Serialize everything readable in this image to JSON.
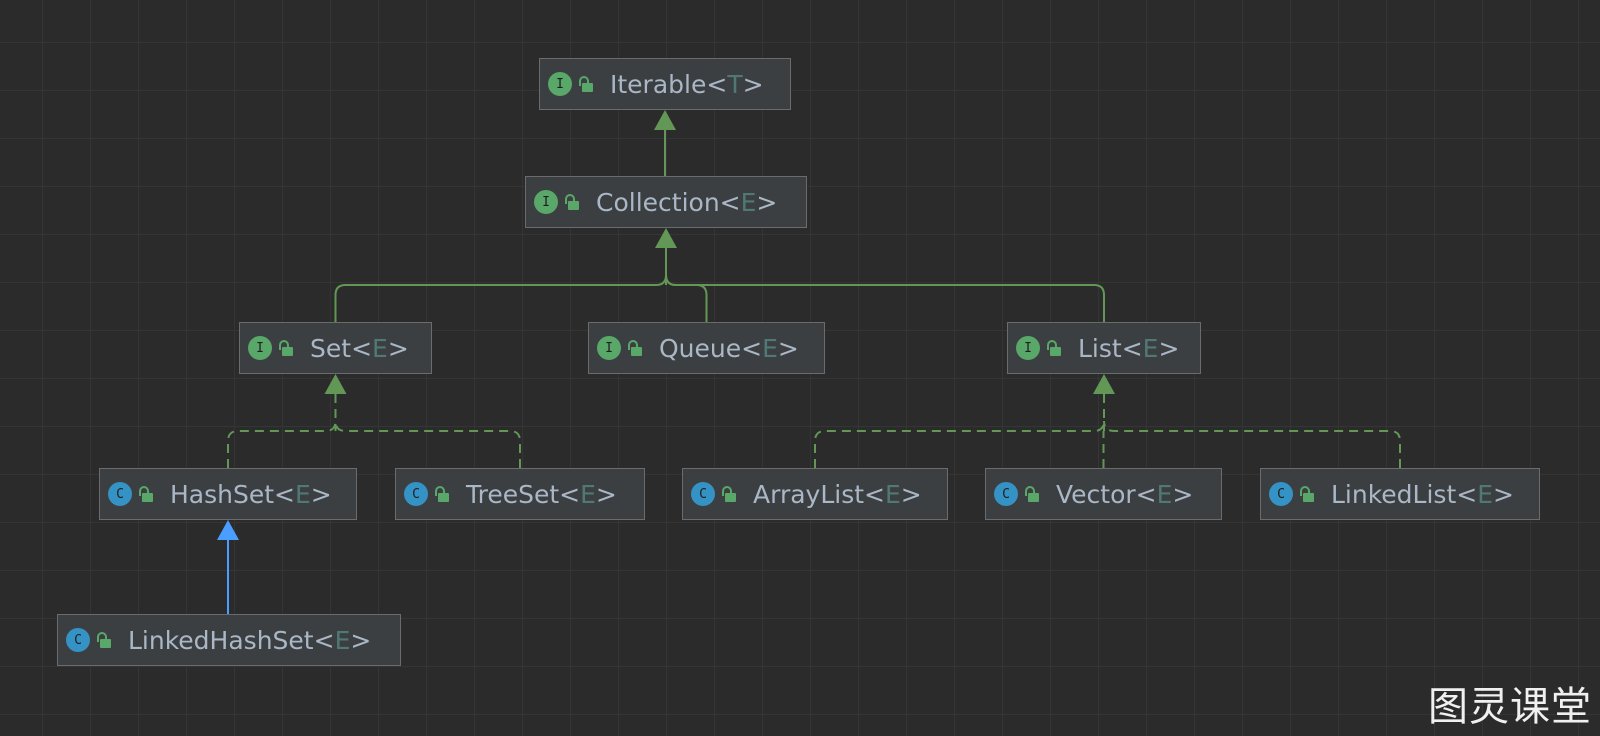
{
  "colors": {
    "background": "#2b2b2b",
    "extends_edge": "#629755",
    "implements_edge": "#629755",
    "class_extends_edge": "#4a9eff",
    "type_param": "#507874",
    "text": "#a9b7c6"
  },
  "nodes": [
    {
      "id": "iterable",
      "name": "Iterable",
      "lt": "<",
      "param": "T",
      "gt": ">",
      "kind": "interface",
      "kind_letter": "I",
      "icon": "interface-icon",
      "access_icon": "unlock-icon"
    },
    {
      "id": "collection",
      "name": "Collection",
      "lt": "<",
      "param": "E",
      "gt": ">",
      "kind": "interface",
      "kind_letter": "I",
      "icon": "interface-icon",
      "access_icon": "unlock-icon"
    },
    {
      "id": "set",
      "name": "Set",
      "lt": "<",
      "param": "E",
      "gt": ">",
      "kind": "interface",
      "kind_letter": "I",
      "icon": "interface-icon",
      "access_icon": "unlock-icon"
    },
    {
      "id": "queue",
      "name": "Queue",
      "lt": "<",
      "param": "E",
      "gt": ">",
      "kind": "interface",
      "kind_letter": "I",
      "icon": "interface-icon",
      "access_icon": "unlock-icon"
    },
    {
      "id": "list",
      "name": "List",
      "lt": "<",
      "param": "E",
      "gt": ">",
      "kind": "interface",
      "kind_letter": "I",
      "icon": "interface-icon",
      "access_icon": "unlock-icon"
    },
    {
      "id": "hashset",
      "name": "HashSet",
      "lt": "<",
      "param": "E",
      "gt": ">",
      "kind": "class",
      "kind_letter": "C",
      "icon": "class-icon",
      "access_icon": "unlock-icon"
    },
    {
      "id": "treeset",
      "name": "TreeSet",
      "lt": "<",
      "param": "E",
      "gt": ">",
      "kind": "class",
      "kind_letter": "C",
      "icon": "class-icon",
      "access_icon": "unlock-icon"
    },
    {
      "id": "arraylist",
      "name": "ArrayList",
      "lt": "<",
      "param": "E",
      "gt": ">",
      "kind": "class",
      "kind_letter": "C",
      "icon": "class-icon",
      "access_icon": "unlock-icon"
    },
    {
      "id": "vector",
      "name": "Vector",
      "lt": "<",
      "param": "E",
      "gt": ">",
      "kind": "class",
      "kind_letter": "C",
      "icon": "class-icon",
      "access_icon": "unlock-icon"
    },
    {
      "id": "linkedlist",
      "name": "LinkedList",
      "lt": "<",
      "param": "E",
      "gt": ">",
      "kind": "class",
      "kind_letter": "C",
      "icon": "class-icon",
      "access_icon": "unlock-icon"
    },
    {
      "id": "linkedhashset",
      "name": "LinkedHashSet",
      "lt": "<",
      "param": "E",
      "gt": ">",
      "kind": "class",
      "kind_letter": "C",
      "icon": "class-icon",
      "access_icon": "unlock-icon"
    }
  ],
  "edges": [
    {
      "from": "collection",
      "to": "iterable",
      "type": "extends"
    },
    {
      "from": "set",
      "to": "collection",
      "type": "extends"
    },
    {
      "from": "queue",
      "to": "collection",
      "type": "extends"
    },
    {
      "from": "list",
      "to": "collection",
      "type": "extends"
    },
    {
      "from": "hashset",
      "to": "set",
      "type": "implements"
    },
    {
      "from": "treeset",
      "to": "set",
      "type": "implements"
    },
    {
      "from": "arraylist",
      "to": "list",
      "type": "implements"
    },
    {
      "from": "vector",
      "to": "list",
      "type": "implements"
    },
    {
      "from": "linkedlist",
      "to": "list",
      "type": "implements"
    },
    {
      "from": "linkedhashset",
      "to": "hashset",
      "type": "class-extends"
    }
  ],
  "watermark": "图灵课堂"
}
